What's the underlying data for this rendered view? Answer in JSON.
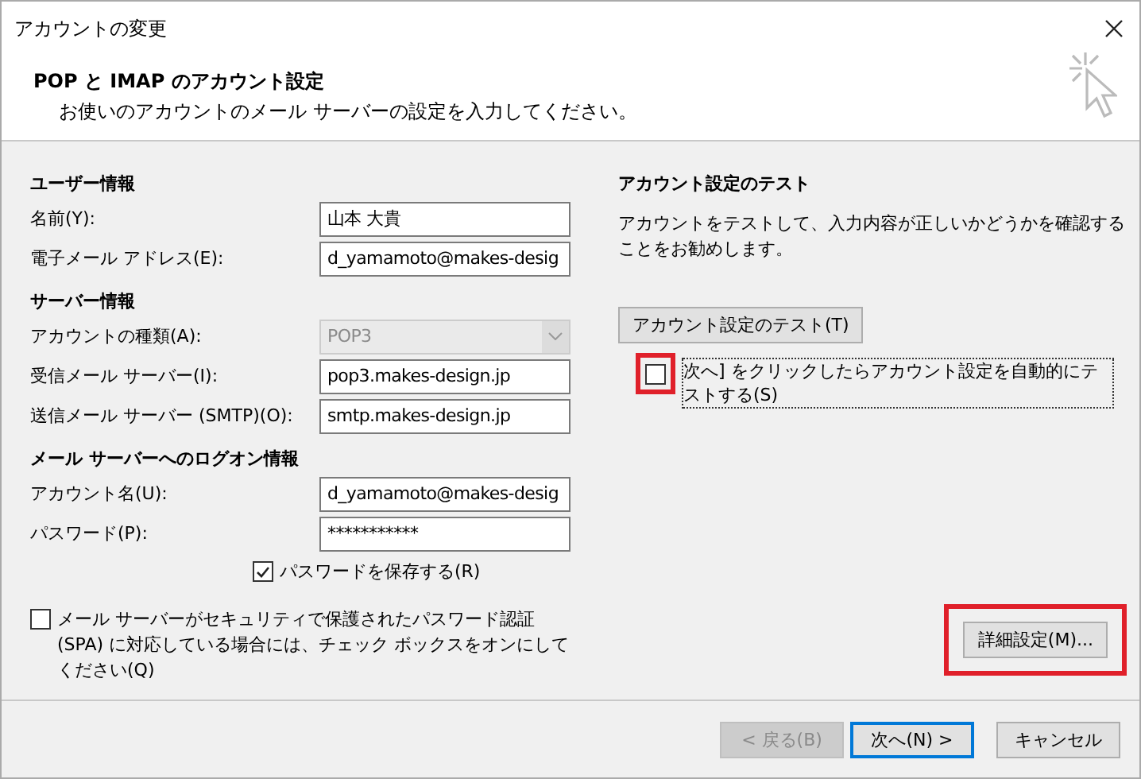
{
  "window": {
    "title": "アカウントの変更"
  },
  "header": {
    "title": "POP と IMAP のアカウント設定",
    "subtitle": "お使いのアカウントのメール サーバーの設定を入力してください。"
  },
  "sections": [
    {
      "heading": "ユーザー情報",
      "fields": [
        {
          "kind": "text",
          "label": "名前(Y):",
          "value": "山本 大貴",
          "disabled": false
        },
        {
          "kind": "text",
          "label": "電子メール アドレス(E):",
          "value": "d_yamamoto@makes-desig",
          "disabled": false
        }
      ]
    },
    {
      "heading": "サーバー情報",
      "fields": [
        {
          "kind": "select",
          "label": "アカウントの種類(A):",
          "value": "POP3",
          "disabled": true
        },
        {
          "kind": "text",
          "label": "受信メール サーバー(I):",
          "value": "pop3.makes-design.jp",
          "disabled": false
        },
        {
          "kind": "text",
          "label": "送信メール サーバー (SMTP)(O):",
          "value": "smtp.makes-design.jp",
          "disabled": false
        }
      ]
    },
    {
      "heading": "メール サーバーへのログオン情報",
      "fields": [
        {
          "kind": "text",
          "label": "アカウント名(U):",
          "value": "d_yamamoto@makes-desig",
          "disabled": false
        },
        {
          "kind": "password",
          "label": "パスワード(P):",
          "value": "***********",
          "disabled": false
        }
      ]
    }
  ],
  "save_password": {
    "label": "パスワードを保存する(R)",
    "checked": true
  },
  "spa": {
    "label": "メール サーバーがセキュリティで保護されたパスワード認証 (SPA) に対応している場合には、チェック ボックスをオンにしてください(Q)",
    "checked": false
  },
  "test": {
    "heading": "アカウント設定のテスト",
    "description": "アカウントをテストして、入力内容が正しいかどうかを確認することをお勧めします。",
    "button": "アカウント設定のテスト(T)",
    "auto_test": {
      "label": "次へ] をクリックしたらアカウント設定を自動的にテストする(S)",
      "checked": false,
      "highlighted": true
    }
  },
  "advanced_button": {
    "label": "詳細設定(M)...",
    "highlighted": true
  },
  "footer_buttons": [
    {
      "label": "< 戻る(B)",
      "disabled": true,
      "default": false
    },
    {
      "label": "次へ(N) >",
      "disabled": false,
      "default": true
    },
    {
      "label": "キャンセル",
      "disabled": false,
      "default": false
    }
  ]
}
